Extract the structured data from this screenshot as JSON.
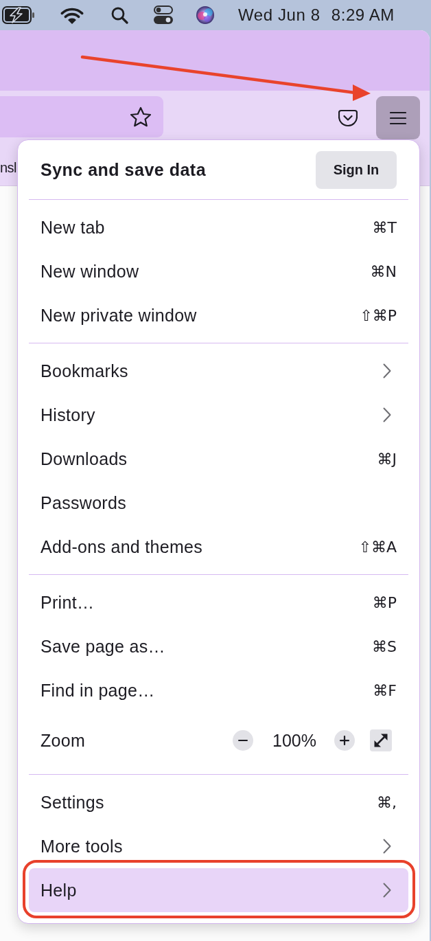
{
  "menu_bar": {
    "date": "Wed Jun 8",
    "time": "8:29 AM"
  },
  "toolbar": {
    "menu_button": {
      "pressed": true,
      "annotated": true
    }
  },
  "bookmarks_bar": [
    {
      "label": "nsl"
    }
  ],
  "menu": {
    "sync": {
      "title": "Sync and save data",
      "button": "Sign In"
    },
    "sections": [
      {
        "items": [
          {
            "kind": "action",
            "label": "New tab",
            "shortcut": "⌘T",
            "selected": false,
            "outlined": false
          },
          {
            "kind": "action",
            "label": "New window",
            "shortcut": "⌘N",
            "selected": false,
            "outlined": false
          },
          {
            "kind": "action",
            "label": "New private window",
            "shortcut": "⇧⌘P",
            "selected": false,
            "outlined": false
          }
        ]
      },
      {
        "items": [
          {
            "kind": "submenu",
            "label": "Bookmarks",
            "selected": false,
            "outlined": false
          },
          {
            "kind": "submenu",
            "label": "History",
            "selected": false,
            "outlined": false
          },
          {
            "kind": "action",
            "label": "Downloads",
            "shortcut": "⌘J",
            "selected": false,
            "outlined": false
          },
          {
            "kind": "action",
            "label": "Passwords",
            "selected": false,
            "outlined": false
          },
          {
            "kind": "action",
            "label": "Add-ons and themes",
            "shortcut": "⇧⌘A",
            "selected": false,
            "outlined": false
          }
        ]
      },
      {
        "items": [
          {
            "kind": "action",
            "label": "Print…",
            "shortcut": "⌘P",
            "selected": false,
            "outlined": false
          },
          {
            "kind": "action",
            "label": "Save page as…",
            "shortcut": "⌘S",
            "selected": false,
            "outlined": false
          },
          {
            "kind": "action",
            "label": "Find in page…",
            "shortcut": "⌘F",
            "selected": false,
            "outlined": false
          },
          {
            "kind": "zoom",
            "label": "Zoom",
            "value": "100%"
          }
        ]
      },
      {
        "items": [
          {
            "kind": "action",
            "label": "Settings",
            "shortcut": "⌘,",
            "selected": false,
            "outlined": false
          },
          {
            "kind": "submenu",
            "label": "More tools",
            "selected": false,
            "outlined": false
          },
          {
            "kind": "submenu",
            "label": "Help",
            "selected": true,
            "outlined": true
          }
        ]
      }
    ]
  }
}
